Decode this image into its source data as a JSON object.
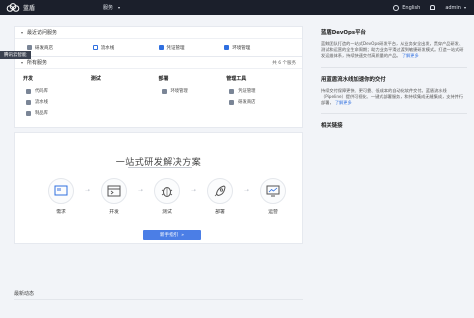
{
  "topbar": {
    "logo_text": "蓝盾",
    "services_label": "服务",
    "language": "English",
    "user": "admin"
  },
  "badge": "腾讯云智能",
  "recent": {
    "title": "最近访问服务",
    "items": [
      {
        "label": "研发商店",
        "icon": "store-icon"
      },
      {
        "label": "流水线",
        "icon": "pipeline-icon"
      },
      {
        "label": "凭证管理",
        "icon": "credential-icon"
      },
      {
        "label": "环境管理",
        "icon": "environment-icon"
      }
    ]
  },
  "services": {
    "title": "所有服务",
    "count": "共 6 个服务",
    "columns": [
      {
        "header": "开发",
        "items": [
          {
            "label": "代码库",
            "icon": "code-icon"
          },
          {
            "label": "流水线",
            "icon": "pipeline-icon"
          },
          {
            "label": "制品库",
            "icon": "artifact-icon"
          }
        ]
      },
      {
        "header": "测试",
        "items": []
      },
      {
        "header": "部署",
        "items": [
          {
            "label": "环境管理",
            "icon": "environment-icon"
          }
        ]
      },
      {
        "header": "管理工具",
        "items": [
          {
            "label": "凭证管理",
            "icon": "credential-icon"
          },
          {
            "label": "研发商店",
            "icon": "store-icon"
          }
        ]
      }
    ]
  },
  "hero": {
    "title": "一站式研发解决方案",
    "steps": [
      {
        "label": "需求",
        "icon": "requirements-icon"
      },
      {
        "label": "开发",
        "icon": "develop-icon"
      },
      {
        "label": "测试",
        "icon": "bug-icon"
      },
      {
        "label": "部署",
        "icon": "rocket-icon"
      },
      {
        "label": "运营",
        "icon": "monitor-icon"
      }
    ],
    "guide_button": "新手指引",
    "guide_arrow": "»"
  },
  "recent_activity": "最新动态",
  "right_panel": {
    "devops_title": "蓝盾DevOps平台",
    "devops_text": "蓝鲸团队打造的一站式DevOps研发平台，从业务安全出发，贯穿产品研发、测试和运营的全生命周期；助力业务平滑过渡到敏捷研发模式。打造一站式研发运维体系，持续快速交付高质量的产品。",
    "devops_link": "了解更多",
    "pipeline_title": "用蓝盾流水线加速你的交付",
    "pipeline_text": "持续交付保障更快、更可靠、低成本的自动化软件交付。蓝盾流水线（Pipeline）提供可视化、一键式部署服务，和持续集成无缝集成，支持并行部署，",
    "pipeline_link": "了解更多",
    "links_title": "相关链接"
  }
}
